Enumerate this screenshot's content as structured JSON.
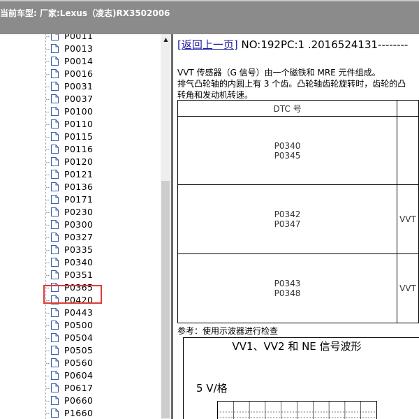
{
  "header": {
    "title": "当前车型:  厂家:Lexus（凌志)RX3502006"
  },
  "tree": {
    "items": [
      {
        "label": "P0011"
      },
      {
        "label": "P0013"
      },
      {
        "label": "P0014"
      },
      {
        "label": "P0016"
      },
      {
        "label": "P0031"
      },
      {
        "label": "P0037"
      },
      {
        "label": "P0100"
      },
      {
        "label": "P0110"
      },
      {
        "label": "P0115"
      },
      {
        "label": "P0116"
      },
      {
        "label": "P0120"
      },
      {
        "label": "P0121"
      },
      {
        "label": "P0136"
      },
      {
        "label": "P0171"
      },
      {
        "label": "P0230"
      },
      {
        "label": "P0300"
      },
      {
        "label": "P0327"
      },
      {
        "label": "P0335"
      },
      {
        "label": "P0340"
      },
      {
        "label": "P0351"
      },
      {
        "label": "P0365"
      },
      {
        "label": "P0420"
      },
      {
        "label": "P0443"
      },
      {
        "label": "P0500"
      },
      {
        "label": "P0504"
      },
      {
        "label": "P0505"
      },
      {
        "label": "P0560"
      },
      {
        "label": "P0604"
      },
      {
        "label": "P0617"
      },
      {
        "label": "P0660"
      },
      {
        "label": "P1660"
      }
    ],
    "selected": "P0340"
  },
  "content": {
    "back_link": "[返回上一页]",
    "record_no": "NO:192PC:1 .2016524131--------",
    "desc_line1": "VVT 传感器（G 信号）由一个磁铁和 MRE 元件组成。",
    "desc_line2": "排气凸轮轴的内圆上有 3 个齿。凸轮轴齿轮旋转时，齿轮的凸",
    "desc_line3": "转角和发动机转速。",
    "table": {
      "header": "DTC 号",
      "rows": [
        {
          "codes": [
            "P0340",
            "P0345"
          ],
          "col2": ""
        },
        {
          "codes": [
            "P0342",
            "P0347"
          ],
          "col2": "VVT"
        },
        {
          "codes": [
            "P0343",
            "P0348"
          ],
          "col2": "VVT"
        }
      ]
    },
    "note": "参考：使用示波器进行检查",
    "waveform": {
      "title": "VV1、VV2 和 NE 信号波形",
      "scale": "5 V/格"
    }
  }
}
